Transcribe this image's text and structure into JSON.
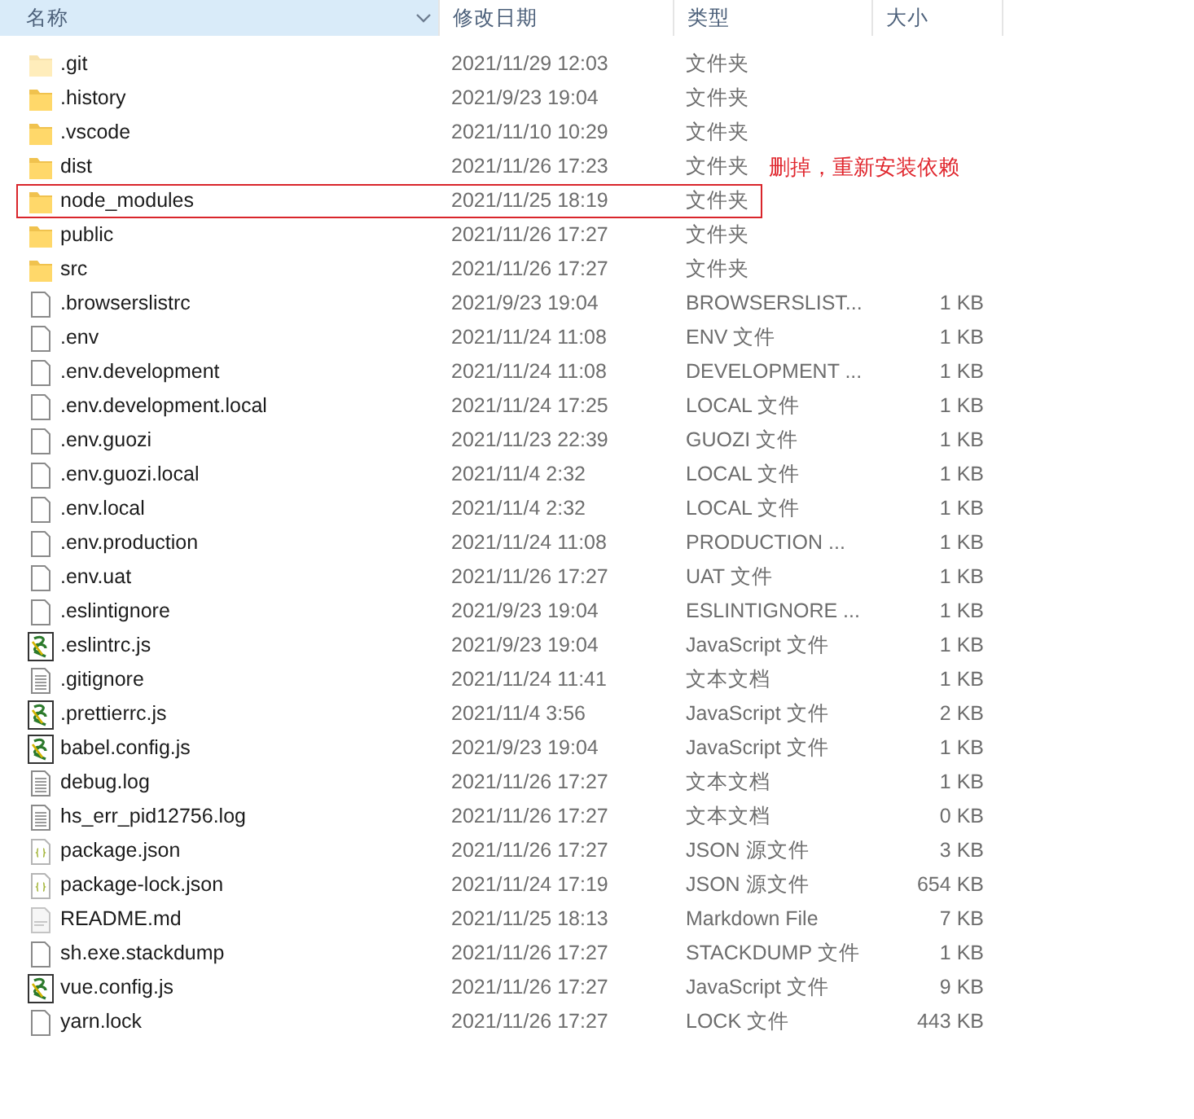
{
  "columns": [
    {
      "label": "名称",
      "sorted": true
    },
    {
      "label": "修改日期",
      "sorted": false
    },
    {
      "label": "类型",
      "sorted": false
    },
    {
      "label": "大小",
      "sorted": false
    }
  ],
  "rows": [
    {
      "name": ".git",
      "date": "2021/11/29 12:03",
      "type": "文件夹",
      "kind": "folder",
      "hidden": true
    },
    {
      "name": ".history",
      "date": "2021/9/23 19:04",
      "type": "文件夹",
      "kind": "folder",
      "hidden": false
    },
    {
      "name": ".vscode",
      "date": "2021/11/10 10:29",
      "type": "文件夹",
      "kind": "folder",
      "hidden": false
    },
    {
      "name": "dist",
      "date": "2021/11/26 17:23",
      "type": "文件夹",
      "kind": "folder",
      "hidden": false
    },
    {
      "name": "node_modules",
      "date": "2021/11/25 18:19",
      "type": "文件夹",
      "kind": "folder",
      "hidden": false,
      "annotation": "删掉，重新安装依赖"
    },
    {
      "name": "public",
      "date": "2021/11/26 17:27",
      "type": "文件夹",
      "kind": "folder",
      "hidden": false
    },
    {
      "name": "src",
      "date": "2021/11/26 17:27",
      "type": "文件夹",
      "kind": "folder",
      "hidden": false
    },
    {
      "name": ".browserslistrc",
      "date": "2021/9/23 19:04",
      "type": "BROWSERSLIST...",
      "size": "1 KB",
      "kind": "file",
      "hidden": false
    },
    {
      "name": ".env",
      "date": "2021/11/24 11:08",
      "type": "ENV 文件",
      "size": "1 KB",
      "kind": "file",
      "hidden": false
    },
    {
      "name": ".env.development",
      "date": "2021/11/24 11:08",
      "type": "DEVELOPMENT ...",
      "size": "1 KB",
      "kind": "file",
      "hidden": false
    },
    {
      "name": ".env.development.local",
      "date": "2021/11/24 17:25",
      "type": "LOCAL 文件",
      "size": "1 KB",
      "kind": "file",
      "hidden": false
    },
    {
      "name": ".env.guozi",
      "date": "2021/11/23 22:39",
      "type": "GUOZI 文件",
      "size": "1 KB",
      "kind": "file",
      "hidden": false
    },
    {
      "name": ".env.guozi.local",
      "date": "2021/11/4 2:32",
      "type": "LOCAL 文件",
      "size": "1 KB",
      "kind": "file",
      "hidden": false
    },
    {
      "name": ".env.local",
      "date": "2021/11/4 2:32",
      "type": "LOCAL 文件",
      "size": "1 KB",
      "kind": "file",
      "hidden": false
    },
    {
      "name": ".env.production",
      "date": "2021/11/24 11:08",
      "type": "PRODUCTION ...",
      "size": "1 KB",
      "kind": "file",
      "hidden": false
    },
    {
      "name": ".env.uat",
      "date": "2021/11/26 17:27",
      "type": "UAT 文件",
      "size": "1 KB",
      "kind": "file",
      "hidden": false
    },
    {
      "name": ".eslintignore",
      "date": "2021/9/23 19:04",
      "type": "ESLINTIGNORE ...",
      "size": "1 KB",
      "kind": "file",
      "hidden": false
    },
    {
      "name": ".eslintrc.js",
      "date": "2021/9/23 19:04",
      "type": "JavaScript 文件",
      "size": "1 KB",
      "kind": "script",
      "hidden": false
    },
    {
      "name": ".gitignore",
      "date": "2021/11/24 11:41",
      "type": "文本文档",
      "size": "1 KB",
      "kind": "text",
      "hidden": false
    },
    {
      "name": ".prettierrc.js",
      "date": "2021/11/4 3:56",
      "type": "JavaScript 文件",
      "size": "2 KB",
      "kind": "script",
      "hidden": false
    },
    {
      "name": "babel.config.js",
      "date": "2021/9/23 19:04",
      "type": "JavaScript 文件",
      "size": "1 KB",
      "kind": "script",
      "hidden": false
    },
    {
      "name": "debug.log",
      "date": "2021/11/26 17:27",
      "type": "文本文档",
      "size": "1 KB",
      "kind": "text",
      "hidden": false
    },
    {
      "name": "hs_err_pid12756.log",
      "date": "2021/11/26 17:27",
      "type": "文本文档",
      "size": "0 KB",
      "kind": "text",
      "hidden": false
    },
    {
      "name": "package.json",
      "date": "2021/11/26 17:27",
      "type": "JSON 源文件",
      "size": "3 KB",
      "kind": "json",
      "hidden": false
    },
    {
      "name": "package-lock.json",
      "date": "2021/11/24 17:19",
      "type": "JSON 源文件",
      "size": "654 KB",
      "kind": "json",
      "hidden": false
    },
    {
      "name": "README.md",
      "date": "2021/11/25 18:13",
      "type": "Markdown File",
      "size": "7 KB",
      "kind": "markdown",
      "hidden": false
    },
    {
      "name": "sh.exe.stackdump",
      "date": "2021/11/26 17:27",
      "type": "STACKDUMP 文件",
      "size": "1 KB",
      "kind": "file",
      "hidden": false
    },
    {
      "name": "vue.config.js",
      "date": "2021/11/26 17:27",
      "type": "JavaScript 文件",
      "size": "9 KB",
      "kind": "script",
      "hidden": false
    },
    {
      "name": "yarn.lock",
      "date": "2021/11/26 17:27",
      "type": "LOCK 文件",
      "size": "443 KB",
      "kind": "file",
      "hidden": false
    }
  ]
}
